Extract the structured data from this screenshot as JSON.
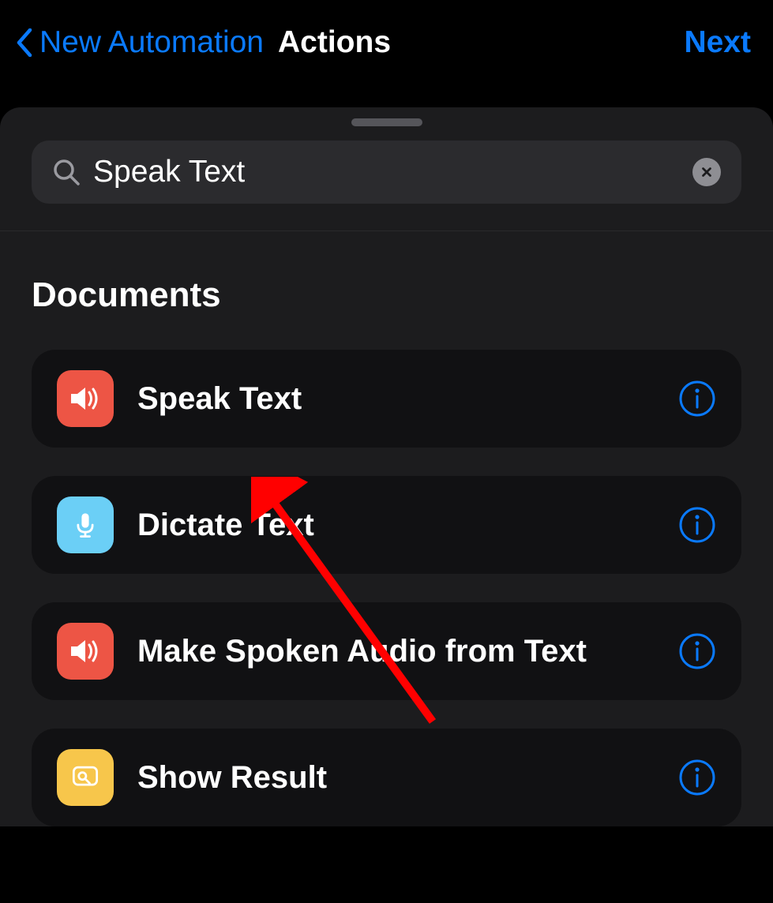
{
  "nav": {
    "back_label": "New Automation",
    "title": "Actions",
    "next_label": "Next"
  },
  "search": {
    "value": "Speak Text",
    "placeholder": "Search"
  },
  "section": {
    "title": "Documents"
  },
  "actions": [
    {
      "label": "Speak Text",
      "icon": "speaker-icon",
      "color": "red"
    },
    {
      "label": "Dictate Text",
      "icon": "mic-icon",
      "color": "blue"
    },
    {
      "label": "Make Spoken Audio from Text",
      "icon": "speaker-icon",
      "color": "red"
    },
    {
      "label": "Show Result",
      "icon": "result-icon",
      "color": "yellow"
    }
  ],
  "colors": {
    "accent": "#0a7aff",
    "red": "#ed5545",
    "blue": "#6bcff6",
    "yellow": "#f7c64b",
    "annotation": "#ff0000"
  }
}
